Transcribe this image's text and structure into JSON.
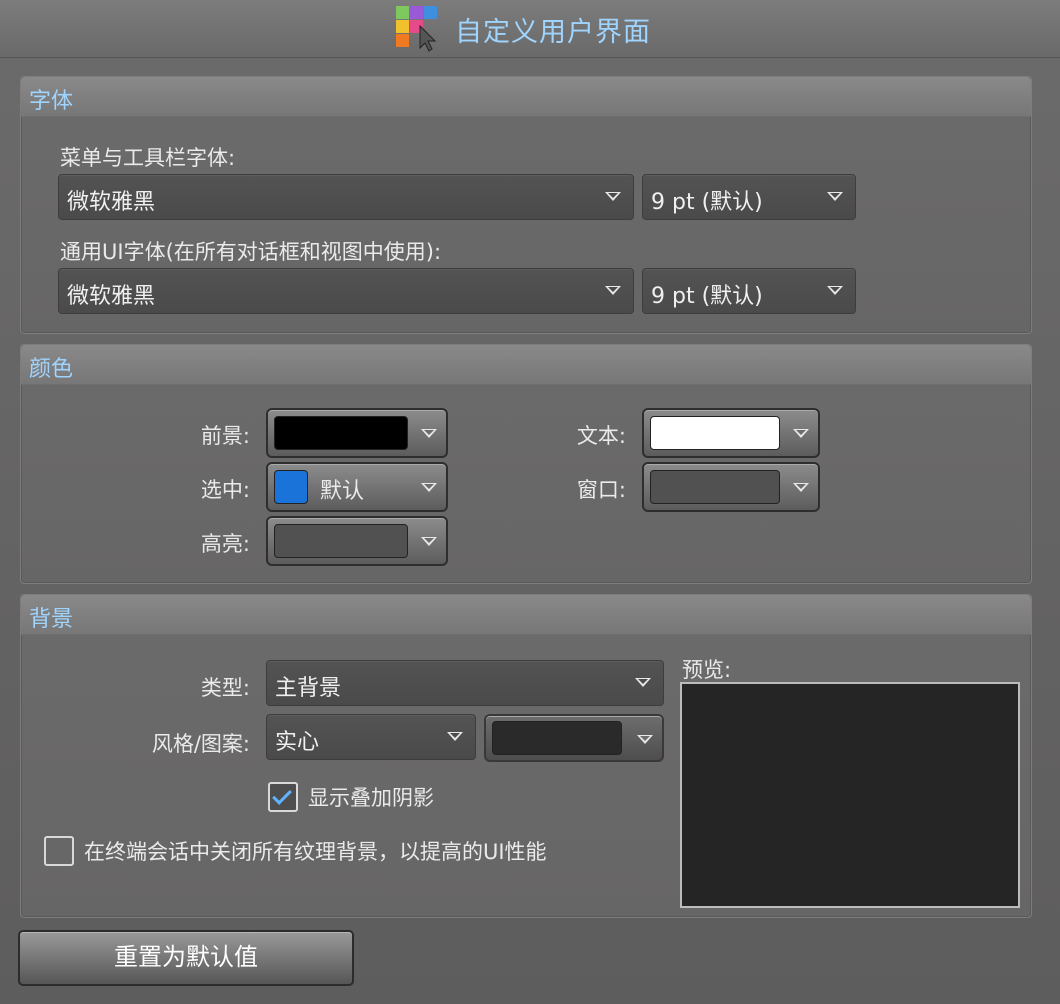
{
  "window": {
    "title": "自定义用户界面"
  },
  "font_section": {
    "header": "字体",
    "menu_font_label": "菜单与工具栏字体:",
    "menu_font_value": "微软雅黑",
    "menu_size_value": "9 pt (默认)",
    "ui_font_label": "通用UI字体(在所有对话框和视图中使用):",
    "ui_font_value": "微软雅黑",
    "ui_size_value": "9 pt (默认)"
  },
  "color_section": {
    "header": "颜色",
    "foreground_label": "前景:",
    "foreground_color": "#000000",
    "selected_label": "选中:",
    "selected_color": "#1a73d9",
    "selected_text": "默认",
    "highlight_label": "高亮:",
    "highlight_color": "#525151",
    "text_label": "文本:",
    "text_color": "#ffffff",
    "window_label": "窗口:",
    "window_color": "#525151"
  },
  "background_section": {
    "header": "背景",
    "type_label": "类型:",
    "type_value": "主背景",
    "style_label": "风格/图案:",
    "style_value": "实心",
    "style_color": "#2a2a2a",
    "preview_label": "预览:",
    "overlay_shadow_label": "显示叠加阴影",
    "overlay_shadow_checked": true,
    "disable_texture_label": "在终端会话中关闭所有纹理背景，以提高的UI性能",
    "disable_texture_checked": false
  },
  "buttons": {
    "reset_label": "重置为默认值"
  }
}
